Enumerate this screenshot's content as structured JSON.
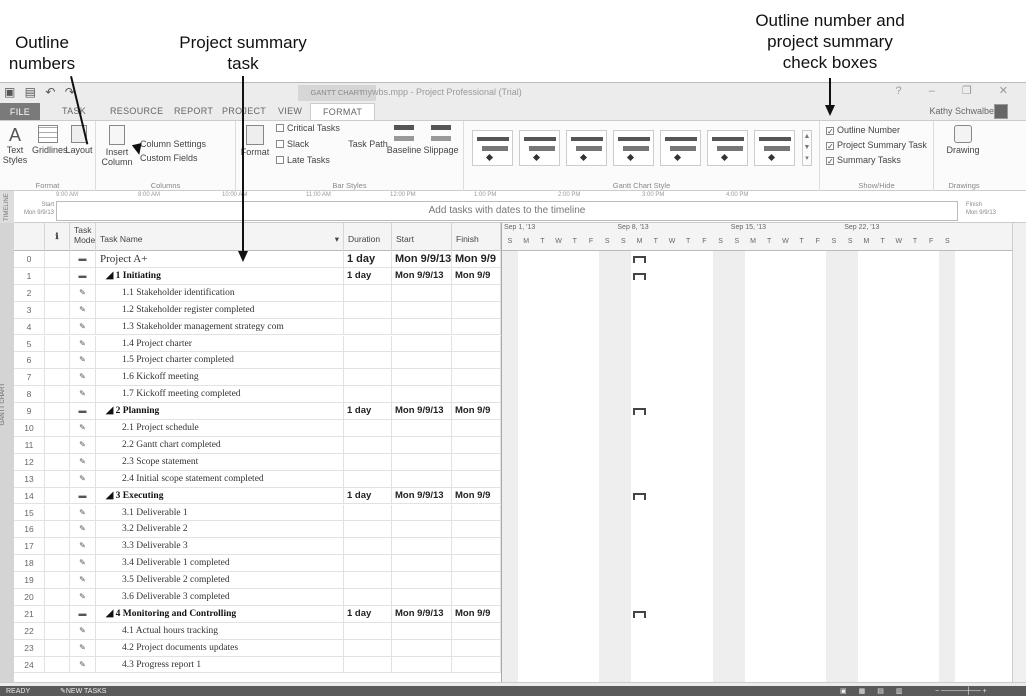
{
  "annotations": {
    "outline_numbers": [
      "Outline",
      "numbers"
    ],
    "project_summary": [
      "Project summary",
      "task"
    ],
    "checkbox_callout": [
      "Outline number and",
      "project summary",
      "check boxes"
    ]
  },
  "window": {
    "title": "mywbs.mpp - Project Professional (Trial)",
    "context_tab": "GANTT CHART TOOLS",
    "user": "Kathy Schwalbe",
    "controls": "? – ❐ ✕"
  },
  "tabs": [
    "FILE",
    "TASK",
    "RESOURCE",
    "REPORT",
    "PROJECT",
    "VIEW",
    "FORMAT"
  ],
  "ribbon": {
    "format_group": {
      "text_styles": "Text Styles",
      "gridlines": "Gridlines",
      "layout": "Layout",
      "label": "Format"
    },
    "columns_group": {
      "insert_column": "Insert Column",
      "column_settings": "Column Settings",
      "custom_fields": "Custom Fields",
      "label": "Columns"
    },
    "bar_styles_group": {
      "format": "Format",
      "critical_tasks": "Critical Tasks",
      "slack": "Slack",
      "late_tasks": "Late Tasks",
      "task_path": "Task Path",
      "baseline": "Baseline",
      "slippage": "Slippage",
      "label": "Bar Styles"
    },
    "gantt_chart_style_label": "Gantt Chart Style",
    "show_hide": {
      "outline_number": "Outline Number",
      "project_summary_task": "Project Summary Task",
      "summary_tasks": "Summary Tasks",
      "label": "Show/Hide"
    },
    "drawings": {
      "drawing": "Drawing",
      "label": "Drawings"
    }
  },
  "timeline": {
    "side_label": "TIMELINE",
    "start_label": "Start",
    "start_date": "Mon 9/9/13",
    "finish_label": "Finish",
    "finish_date": "Mon 9/9/13",
    "hint": "Add tasks with dates to the timeline",
    "ruler": [
      "9:00 AM",
      "8:00 AM",
      "10:00 AM",
      "11:00 AM",
      "12:00 PM",
      "1:00 PM",
      "2:00 PM",
      "3:00 PM",
      "4:00 PM"
    ]
  },
  "grid": {
    "side_label": "GANTT CHART",
    "columns": {
      "info": "ℹ",
      "task_mode": "Task Mode",
      "task_name": "Task Name",
      "duration": "Duration",
      "start": "Start",
      "finish": "Finish"
    },
    "rows": [
      {
        "id": "0",
        "name": "Project A+",
        "duration": "1 day",
        "start": "Mon 9/9/13",
        "finish": "Mon 9/9",
        "type": "proj"
      },
      {
        "id": "1",
        "name": "◢ 1 Initiating",
        "duration": "1 day",
        "start": "Mon 9/9/13",
        "finish": "Mon 9/9",
        "type": "sum"
      },
      {
        "id": "2",
        "name": "1.1 Stakeholder identification"
      },
      {
        "id": "3",
        "name": "1.2 Stakeholder register completed"
      },
      {
        "id": "4",
        "name": "1.3 Stakeholder management strategy com"
      },
      {
        "id": "5",
        "name": "1.4 Project charter"
      },
      {
        "id": "6",
        "name": "1.5 Project charter completed"
      },
      {
        "id": "7",
        "name": "1.6 Kickoff meeting"
      },
      {
        "id": "8",
        "name": "1.7 Kickoff meeting completed"
      },
      {
        "id": "9",
        "name": "◢ 2 Planning",
        "duration": "1 day",
        "start": "Mon 9/9/13",
        "finish": "Mon 9/9",
        "type": "sum"
      },
      {
        "id": "10",
        "name": "2.1 Project schedule"
      },
      {
        "id": "11",
        "name": "2.2 Gantt chart completed"
      },
      {
        "id": "12",
        "name": "2.3 Scope statement"
      },
      {
        "id": "13",
        "name": "2.4 Initial scope statement completed"
      },
      {
        "id": "14",
        "name": "◢ 3 Executing",
        "duration": "1 day",
        "start": "Mon 9/9/13",
        "finish": "Mon 9/9",
        "type": "sum"
      },
      {
        "id": "15",
        "name": "3.1 Deliverable 1"
      },
      {
        "id": "16",
        "name": "3.2 Deliverable 2"
      },
      {
        "id": "17",
        "name": "3.3 Deliverable 3"
      },
      {
        "id": "18",
        "name": "3.4 Deliverable 1 completed"
      },
      {
        "id": "19",
        "name": "3.5 Deliverable 2 completed"
      },
      {
        "id": "20",
        "name": "3.6 Deliverable 3 completed"
      },
      {
        "id": "21",
        "name": "◢ 4 Monitoring and Controlling",
        "duration": "1 day",
        "start": "Mon 9/9/13",
        "finish": "Mon 9/9",
        "type": "sum"
      },
      {
        "id": "22",
        "name": "4.1 Actual hours tracking"
      },
      {
        "id": "23",
        "name": "4.2 Project documents updates"
      },
      {
        "id": "24",
        "name": "4.3 Progress report 1"
      }
    ]
  },
  "gantt": {
    "weeks": [
      "Sep 1, '13",
      "Sep 8, '13",
      "Sep 15, '13",
      "Sep 22, '13"
    ],
    "days": [
      "S",
      "M",
      "T",
      "W",
      "T",
      "F",
      "S"
    ]
  },
  "status": {
    "ready": "READY",
    "new_tasks": "NEW TASKS : MANUALLY SCHEDULED"
  }
}
